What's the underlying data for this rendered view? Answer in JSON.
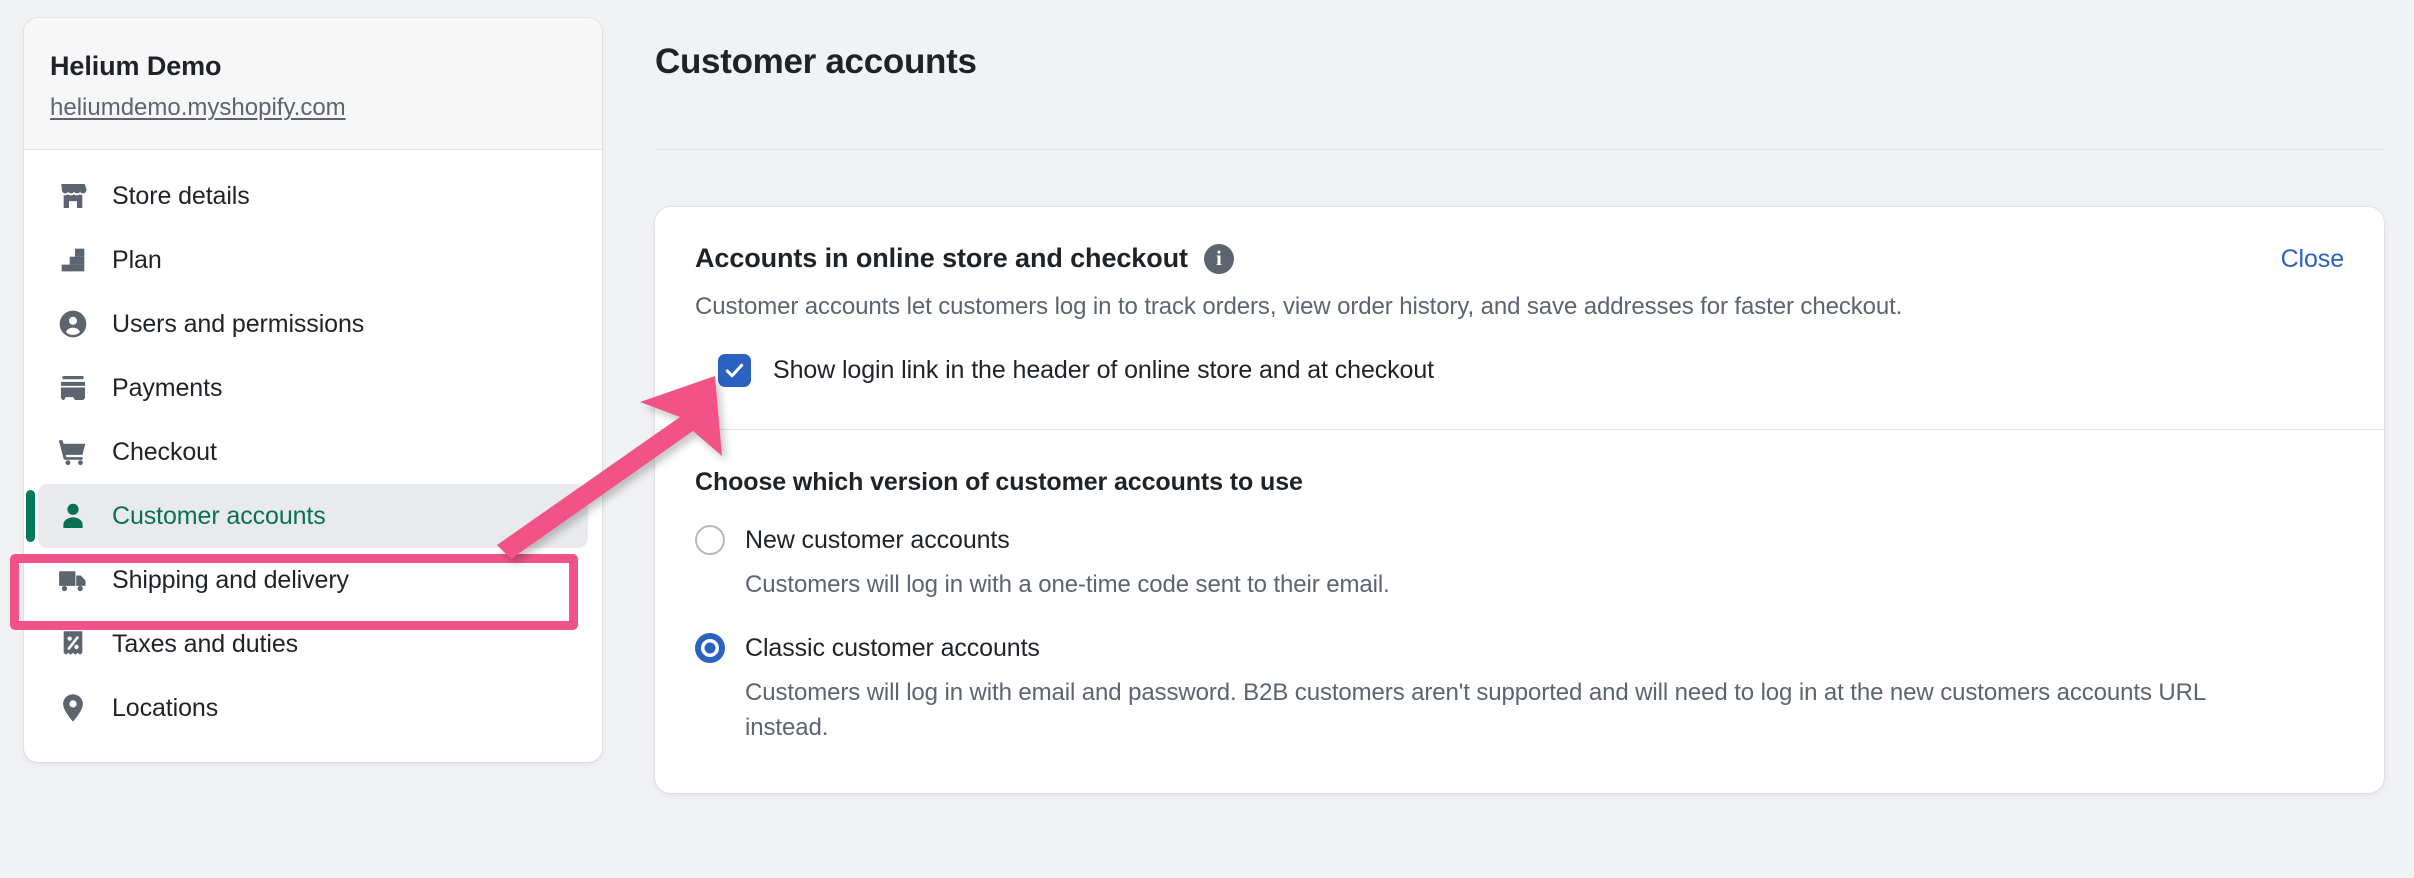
{
  "sidebar": {
    "store_name": "Helium Demo",
    "store_url": "heliumdemo.myshopify.com",
    "items": [
      {
        "label": "Store details",
        "icon": "store-icon",
        "active": false
      },
      {
        "label": "Plan",
        "icon": "plan-steps-icon",
        "active": false
      },
      {
        "label": "Users and permissions",
        "icon": "user-circle-icon",
        "active": false
      },
      {
        "label": "Payments",
        "icon": "payment-card-icon",
        "active": false
      },
      {
        "label": "Checkout",
        "icon": "shopping-cart-icon",
        "active": false
      },
      {
        "label": "Customer accounts",
        "icon": "person-icon",
        "active": true
      },
      {
        "label": "Shipping and delivery",
        "icon": "delivery-truck-icon",
        "active": false
      },
      {
        "label": "Taxes and duties",
        "icon": "receipt-percent-icon",
        "active": false
      },
      {
        "label": "Locations",
        "icon": "map-pin-icon",
        "active": false
      }
    ]
  },
  "main": {
    "page_title": "Customer accounts",
    "card": {
      "title": "Accounts in online store and checkout",
      "info_icon": "info-icon",
      "close_label": "Close",
      "description": "Customer accounts let customers log in to track orders, view order history, and save addresses for faster checkout.",
      "checkbox": {
        "label": "Show login link in the header of online store and at checkout",
        "checked": true
      },
      "section_heading": "Choose which version of customer accounts to use",
      "options": [
        {
          "label": "New customer accounts",
          "description": "Customers will log in with a one-time code sent to their email.",
          "selected": false
        },
        {
          "label": "Classic customer accounts",
          "description": "Customers will log in with email and password. B2B customers aren't supported and will need to log in at the new customers accounts URL instead.",
          "selected": true
        }
      ]
    }
  },
  "annotations": {
    "highlight_color": "#f15387",
    "arrow": "pink-arrow-annotation",
    "box": "pink-highlight-box"
  },
  "colors": {
    "accent_green": "#007a5c",
    "link_blue": "#2b62c1",
    "annotation_pink": "#f15387",
    "page_background": "#f1f2f4"
  }
}
